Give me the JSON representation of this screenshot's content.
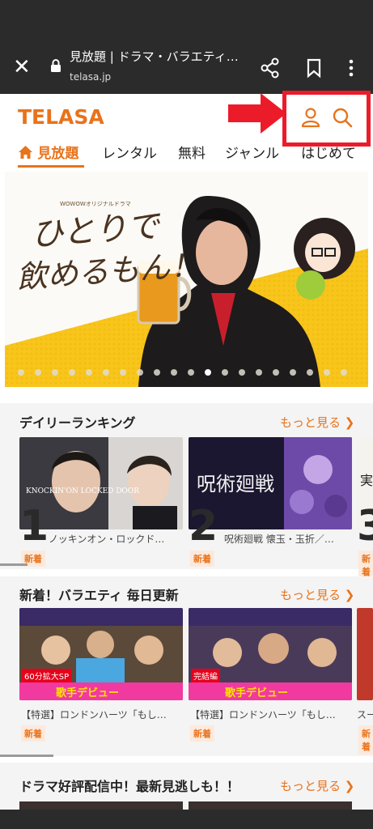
{
  "browser": {
    "title": "見放題 | ドラマ・バラエティ…",
    "url": "telasa.jp"
  },
  "site": {
    "logo": "TELASA",
    "nav": [
      {
        "label": "見放題"
      },
      {
        "label": "レンタル"
      },
      {
        "label": "無料"
      },
      {
        "label": "ジャンル"
      },
      {
        "label": "はじめて"
      }
    ]
  },
  "hero": {
    "small_caption": "WOWOWオリジナルドラマ",
    "headline_line1": "ひとりで",
    "headline_line2": "飲めるもん！",
    "dot_count": 20,
    "active_dot": 11
  },
  "sections": [
    {
      "title": "デイリーランキング",
      "more": "もっと見る",
      "items": [
        {
          "rank": "1",
          "caption": "ノッキンオン・ロックド…",
          "badge": "新着",
          "art_text": "KNOCKIN'ON LOCKED DOOR"
        },
        {
          "rank": "2",
          "caption": "呪術廻戦 懐玉・玉折／…",
          "badge": "新着",
          "art_text": "呪術廻戦"
        },
        {
          "rank": "3",
          "caption": "",
          "badge": "新着",
          "art_text": "実"
        }
      ]
    },
    {
      "title": "新着！バラエティ 毎日更新",
      "more": "もっと見る",
      "items": [
        {
          "caption": "【特選】ロンドンハーツ「もし…",
          "badge": "新着",
          "tag": "60分拡大SP",
          "banner": "歌手デビュー"
        },
        {
          "caption": "【特選】ロンドンハーツ「もし…",
          "badge": "新着",
          "tag": "完結編",
          "banner": "歌手デビュー"
        },
        {
          "caption": "スー",
          "badge": "新着",
          "tag": "",
          "banner": ""
        }
      ]
    },
    {
      "title": "ドラマ好評配信中！最新見逃しも！！",
      "more": "もっと見る"
    }
  ]
}
